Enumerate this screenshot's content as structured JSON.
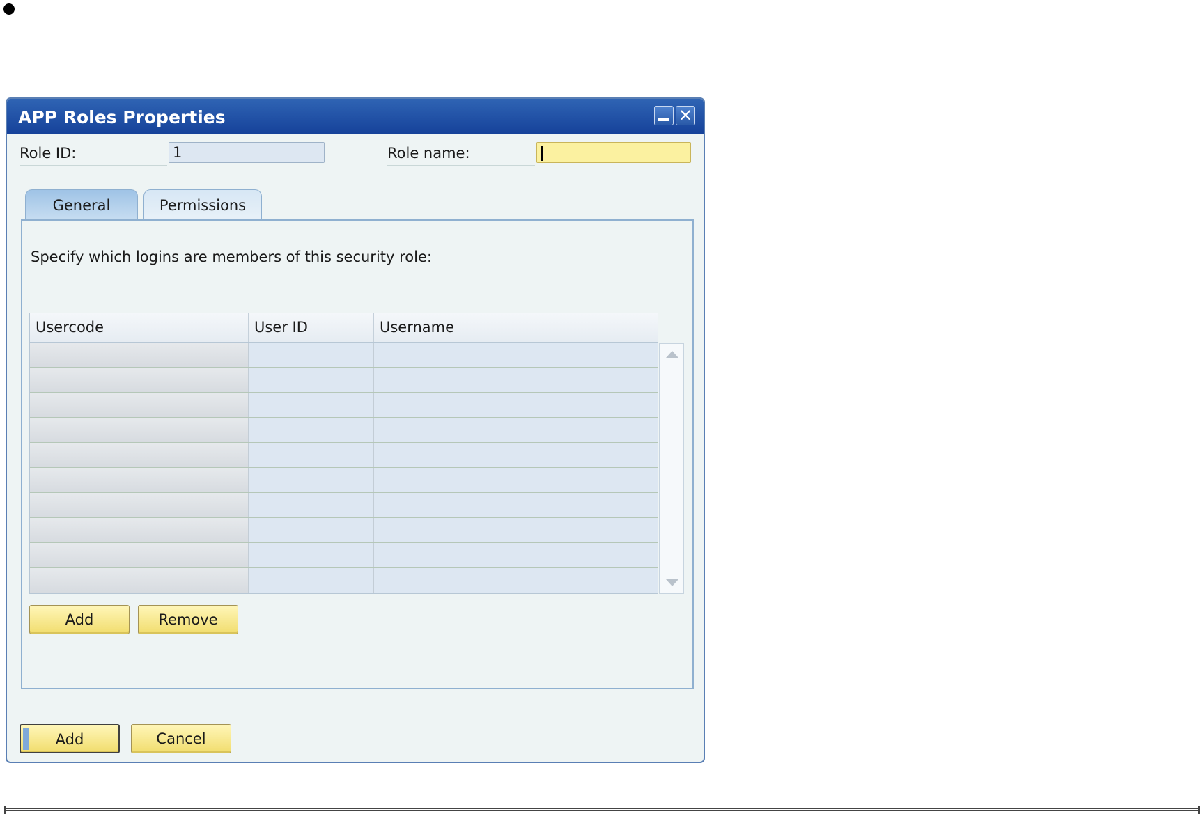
{
  "window": {
    "title": "APP Roles Properties"
  },
  "header": {
    "role_id_label": "Role ID:",
    "role_id_value": "1",
    "role_name_label": "Role name:",
    "role_name_value": ""
  },
  "tabs": [
    {
      "label": "General",
      "active": true
    },
    {
      "label": "Permissions",
      "active": false
    }
  ],
  "general": {
    "instruction": "Specify which logins are members of this security role:",
    "columns": [
      "Usercode",
      "User ID",
      "Username"
    ],
    "rows": [
      [
        "",
        "",
        ""
      ],
      [
        "",
        "",
        ""
      ],
      [
        "",
        "",
        ""
      ],
      [
        "",
        "",
        ""
      ],
      [
        "",
        "",
        ""
      ],
      [
        "",
        "",
        ""
      ],
      [
        "",
        "",
        ""
      ],
      [
        "",
        "",
        ""
      ],
      [
        "",
        "",
        ""
      ],
      [
        "",
        "",
        ""
      ]
    ],
    "add_label": "Add",
    "remove_label": "Remove"
  },
  "footer": {
    "add_label": "Add",
    "cancel_label": "Cancel"
  },
  "icons": {
    "minimize": "minimize-icon",
    "close": "close-icon",
    "scroll_up": "scroll-up-arrow-icon",
    "scroll_down": "scroll-down-arrow-icon"
  },
  "colors": {
    "titlebar": "#1f52a6",
    "button_yellow": "#f5e58a",
    "role_name_field": "#fbf1a0",
    "panel_background": "#eef4f4"
  }
}
